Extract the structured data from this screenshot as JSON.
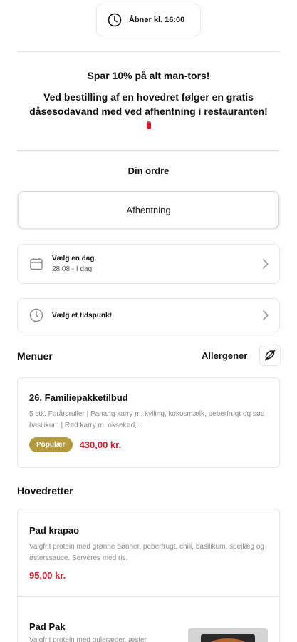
{
  "header": {
    "hours_text": "Åbner kl. 16:00",
    "hours_icon": "clock-icon"
  },
  "promo": {
    "line1": "Spar 10% på alt man-tors!",
    "line2": "Ved bestilling af en hovedret følger en gratis dåsesodavand med ved afhentning i restauranten!",
    "icon": "soda-can-icon"
  },
  "order": {
    "title": "Din ordre",
    "pickup_label": "Afhentning",
    "day_picker": {
      "title": "Vælg en dag",
      "value": "28.08 - I dag",
      "icon": "calendar-icon"
    },
    "time_picker": {
      "title": "Vælg et tidspunkt",
      "icon": "clock-icon"
    }
  },
  "menus": {
    "heading": "Menuer",
    "allergen_label": "Allergener",
    "allergen_icon": "allergen-icon",
    "items": [
      {
        "name": "26. Familiepakketilbud",
        "description": "5 stk. Forårsruller | Panang karry m. kylling, kokosmælk, peberfrugt og sød basilikum | Rød karry m. oksekød,...",
        "badge": "Populær",
        "price": "430,00 kr."
      }
    ]
  },
  "mains": {
    "heading": "Hovedretter",
    "items": [
      {
        "name": "Pad krapao",
        "description": "Valgfrit protein med grønne bønner, peberfrugt, chili, basilikum, spejlæg og østerssauce. Serveres med ris.",
        "price": "95,00 kr."
      },
      {
        "name": "Pad Pak",
        "description": "Valgfrit protein med guleræder, æster"
      }
    ]
  },
  "colors": {
    "price": "#d7192c",
    "badge": "#b39a3d",
    "border": "#e6e6e6"
  }
}
